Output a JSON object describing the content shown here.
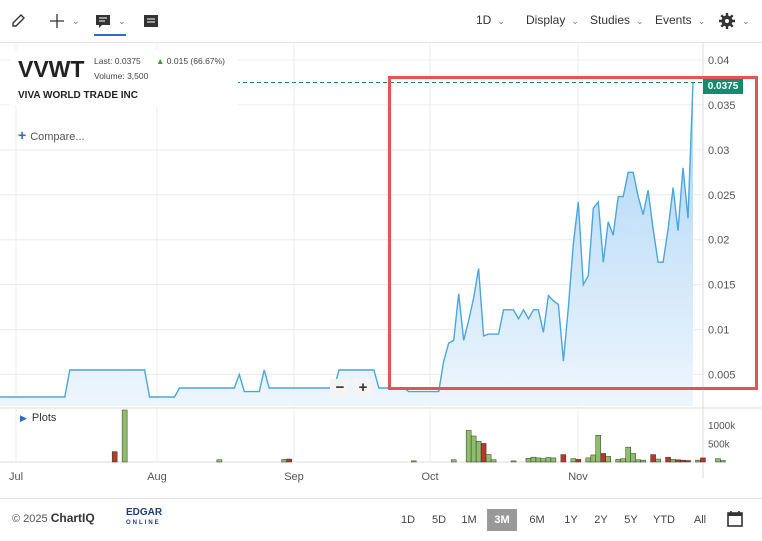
{
  "toolbar": {
    "interval": "1D",
    "menus": [
      "Display",
      "Studies",
      "Events"
    ],
    "icons": [
      "pencil-icon",
      "crosshair-icon",
      "comment-icon",
      "table-icon",
      "gear-icon"
    ]
  },
  "header": {
    "symbol": "VVWT",
    "company": "VIVA WORLD TRADE INC",
    "last_label": "Last: 0.0375",
    "volume_label": "Volume: 3,500",
    "change_label": "0.015 (66.67%)"
  },
  "compare_label": "Compare...",
  "plots_label": "Plots",
  "zoom": {
    "minus": "−",
    "plus": "+"
  },
  "current_price_label": "0.0375",
  "footer": {
    "copyright": "© 2025",
    "brand": "ChartIQ",
    "edgar": "EDGAR",
    "edgar_sub": "ONLINE",
    "ranges": [
      "1D",
      "5D",
      "1M",
      "3M",
      "6M",
      "1Y",
      "2Y",
      "5Y",
      "YTD",
      "All"
    ],
    "active_range": "3M"
  },
  "colors": {
    "line": "#4aa6dd",
    "area_top": "#a9d3f6",
    "area_bottom": "#eef6fd",
    "up_volume": "#8fbe6a",
    "down_volume": "#b5382a",
    "last_price": "#148a6f",
    "highlight": "#e05555"
  },
  "chart_data": {
    "type": "area",
    "x_ticks": [
      "Jul",
      "Aug",
      "Sep",
      "Oct",
      "Nov"
    ],
    "y_ticks": [
      "0.005",
      "0.01",
      "0.015",
      "0.02",
      "0.025",
      "0.03",
      "0.035",
      "0.04"
    ],
    "ylim": [
      0.0015,
      0.042
    ],
    "volume_ticks": [
      "500k",
      "1000k"
    ],
    "volume_max": 1400000,
    "price_series": [
      0.0025,
      0.0025,
      0.0025,
      0.0025,
      0.0025,
      0.0025,
      0.0025,
      0.0025,
      0.0025,
      0.0025,
      0.0025,
      0.0025,
      0.0025,
      0.0025,
      0.0055,
      0.0055,
      0.0055,
      0.0055,
      0.0055,
      0.0055,
      0.0055,
      0.0055,
      0.0055,
      0.0055,
      0.0055,
      0.0055,
      0.0055,
      0.0055,
      0.0055,
      0.0055,
      0.0025,
      0.0025,
      0.0025,
      0.0025,
      0.0025,
      0.0025,
      0.0035,
      0.0035,
      0.0035,
      0.0035,
      0.0035,
      0.0035,
      0.0035,
      0.0035,
      0.0035,
      0.0035,
      0.0035,
      0.0035,
      0.005,
      0.0031,
      0.0031,
      0.0031,
      0.0031,
      0.0055,
      0.0035,
      0.0035,
      0.0035,
      0.0035,
      0.0035,
      0.0035,
      0.0035,
      0.0035,
      0.0035,
      0.0035,
      0.0035,
      0.0035,
      0.0035,
      0.0035,
      0.0055,
      0.0055,
      0.0055,
      0.0055,
      0.0055,
      0.0055,
      0.0055,
      0.0055,
      0.0035,
      0.0035,
      0.0035,
      0.0035,
      0.0035,
      0.0035,
      0.0031,
      0.0031,
      0.0031,
      0.0031,
      0.0031,
      0.0031,
      0.0031,
      0.0065,
      0.0085,
      0.0088,
      0.014,
      0.0088,
      0.011,
      0.0135,
      0.0168,
      0.0093,
      0.0095,
      0.0095,
      0.0095,
      0.0122,
      0.0122,
      0.0122,
      0.0112,
      0.0122,
      0.0112,
      0.0122,
      0.0122,
      0.0097,
      0.0138,
      0.0132,
      0.0128,
      0.0065,
      0.0125,
      0.0195,
      0.0242,
      0.015,
      0.016,
      0.0235,
      0.0242,
      0.0175,
      0.022,
      0.0205,
      0.0248,
      0.0248,
      0.0275,
      0.0275,
      0.0248,
      0.0228,
      0.0255,
      0.0212,
      0.0175,
      0.0175,
      0.0212,
      0.0258,
      0.021,
      0.028,
      0.0224,
      0.0375
    ],
    "volume": [
      {
        "x": 23,
        "v": 280000,
        "dir": "down"
      },
      {
        "x": 25,
        "v": 1400000,
        "dir": "up"
      },
      {
        "x": 44,
        "v": 60000,
        "dir": "up"
      },
      {
        "x": 57,
        "v": 70000,
        "dir": "up"
      },
      {
        "x": 58,
        "v": 80000,
        "dir": "down"
      },
      {
        "x": 83,
        "v": 30000,
        "dir": "up"
      },
      {
        "x": 91,
        "v": 60000,
        "dir": "up"
      },
      {
        "x": 94,
        "v": 850000,
        "dir": "up"
      },
      {
        "x": 95,
        "v": 700000,
        "dir": "up"
      },
      {
        "x": 96,
        "v": 560000,
        "dir": "up"
      },
      {
        "x": 97,
        "v": 500000,
        "dir": "down"
      },
      {
        "x": 98,
        "v": 200000,
        "dir": "up"
      },
      {
        "x": 99,
        "v": 60000,
        "dir": "up"
      },
      {
        "x": 103,
        "v": 30000,
        "dir": "up"
      },
      {
        "x": 106,
        "v": 100000,
        "dir": "up"
      },
      {
        "x": 107,
        "v": 130000,
        "dir": "up"
      },
      {
        "x": 108,
        "v": 110000,
        "dir": "up"
      },
      {
        "x": 109,
        "v": 90000,
        "dir": "up"
      },
      {
        "x": 110,
        "v": 120000,
        "dir": "up"
      },
      {
        "x": 111,
        "v": 110000,
        "dir": "up"
      },
      {
        "x": 113,
        "v": 200000,
        "dir": "down"
      },
      {
        "x": 115,
        "v": 90000,
        "dir": "up"
      },
      {
        "x": 116,
        "v": 70000,
        "dir": "down"
      },
      {
        "x": 118,
        "v": 110000,
        "dir": "up"
      },
      {
        "x": 119,
        "v": 190000,
        "dir": "up"
      },
      {
        "x": 120,
        "v": 720000,
        "dir": "up"
      },
      {
        "x": 121,
        "v": 230000,
        "dir": "down"
      },
      {
        "x": 122,
        "v": 150000,
        "dir": "up"
      },
      {
        "x": 124,
        "v": 70000,
        "dir": "up"
      },
      {
        "x": 125,
        "v": 90000,
        "dir": "up"
      },
      {
        "x": 126,
        "v": 400000,
        "dir": "up"
      },
      {
        "x": 127,
        "v": 230000,
        "dir": "up"
      },
      {
        "x": 128,
        "v": 60000,
        "dir": "up"
      },
      {
        "x": 129,
        "v": 50000,
        "dir": "up"
      },
      {
        "x": 131,
        "v": 200000,
        "dir": "down"
      },
      {
        "x": 132,
        "v": 80000,
        "dir": "up"
      },
      {
        "x": 134,
        "v": 130000,
        "dir": "down"
      },
      {
        "x": 135,
        "v": 70000,
        "dir": "up"
      },
      {
        "x": 136,
        "v": 60000,
        "dir": "down"
      },
      {
        "x": 137,
        "v": 50000,
        "dir": "down"
      },
      {
        "x": 138,
        "v": 40000,
        "dir": "down"
      },
      {
        "x": 140,
        "v": 50000,
        "dir": "up"
      },
      {
        "x": 141,
        "v": 110000,
        "dir": "down"
      },
      {
        "x": 144,
        "v": 90000,
        "dir": "up"
      },
      {
        "x": 145,
        "v": 40000,
        "dir": "up"
      }
    ]
  }
}
